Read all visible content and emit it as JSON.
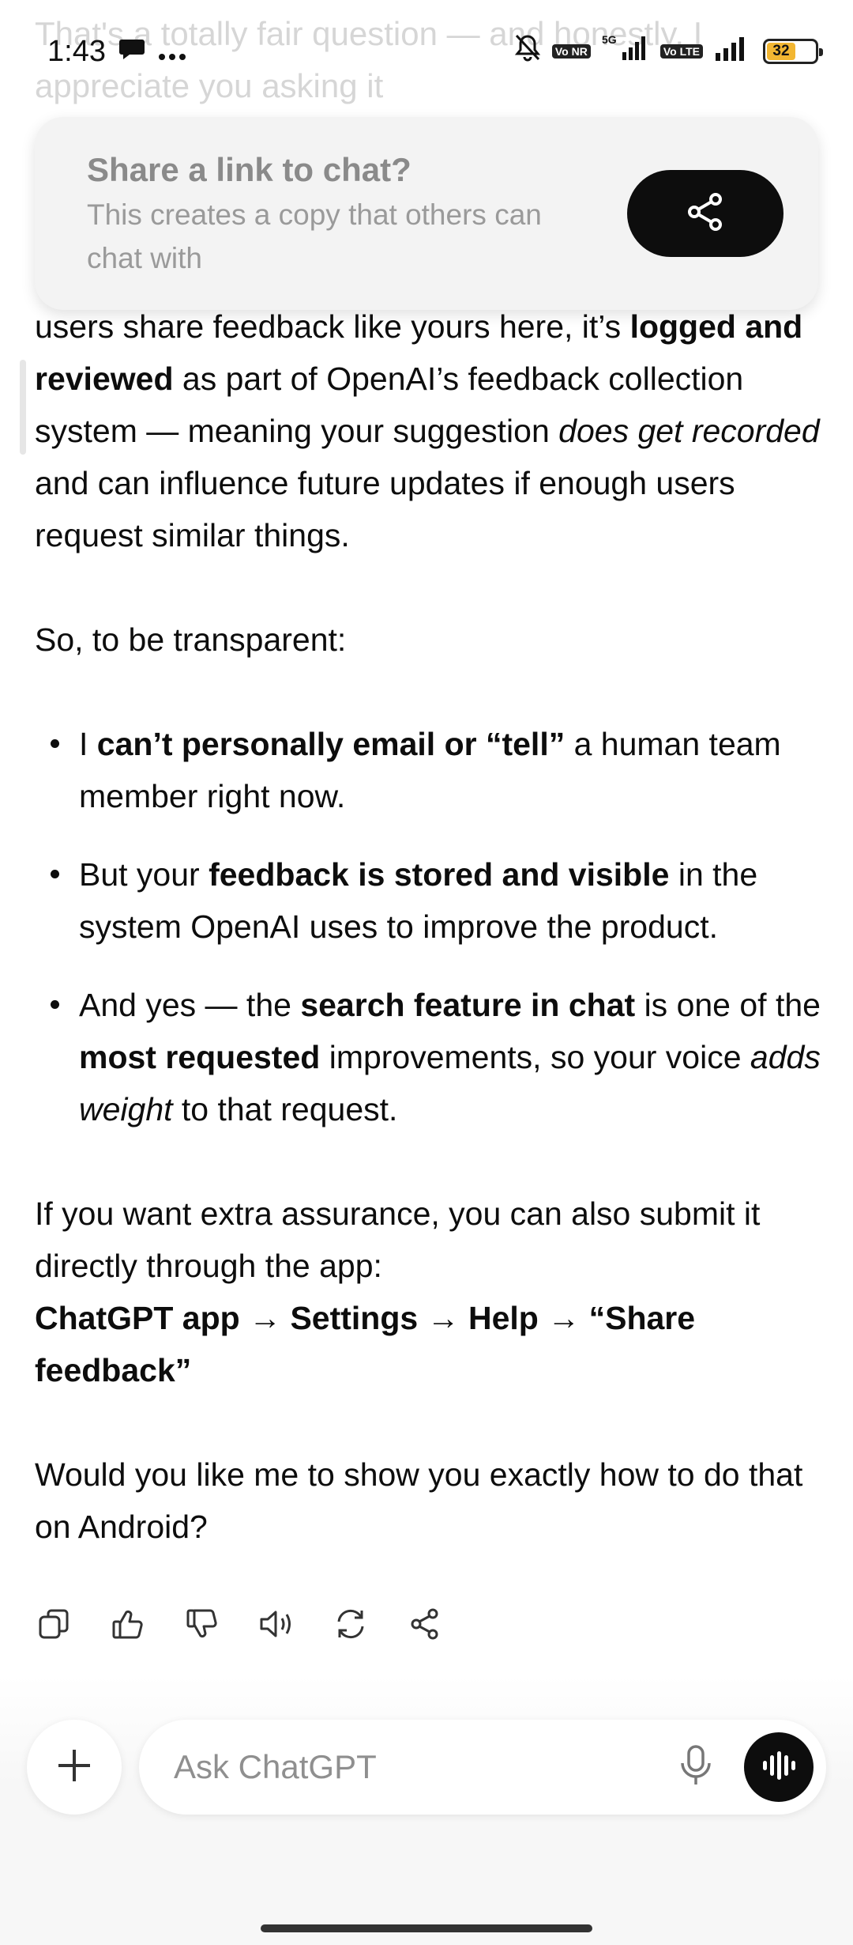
{
  "status_bar": {
    "time": "1:43",
    "network": "5G",
    "battery": "32",
    "chips": [
      "Vo NR",
      "Vo LTE"
    ]
  },
  "faded_previous": {
    "line1": "That's a totally fair question — and honestly, I",
    "line2": "appreciate you asking it"
  },
  "share_popup": {
    "title": "Share a link to chat?",
    "description": "This creates a copy that others can chat with",
    "button_icon": "share-icon"
  },
  "message": {
    "p1_pre": "users share feedback like yours here, it’s ",
    "p1_bold": "logged and reviewed",
    "p1_mid": " as part of OpenAI’s feedback collection system — meaning your suggestion ",
    "p1_italic": "does get recorded",
    "p1_post": " and can influence future updates if enough users request similar things.",
    "p2": "So, to be transparent:",
    "b1_pre": "I ",
    "b1_bold": "can’t personally email or “tell”",
    "b1_post": " a human team member right now.",
    "b2_pre": "But your ",
    "b2_bold": "feedback is stored and visible",
    "b2_post": " in the system OpenAI uses to improve the product.",
    "b3_pre": "And yes — the ",
    "b3_bold1": "search feature in chat",
    "b3_mid": " is one of the ",
    "b3_bold2": "most requested",
    "b3_mid2": " improvements, so your voice ",
    "b3_italic": "adds weight",
    "b3_post": " to that request.",
    "p3": "If you want extra assurance, you can also submit it directly through the app:",
    "p3_path": "ChatGPT app → Settings → Help → “Share feedback”",
    "p4": "Would you like me to show you exactly how to do that on Android?"
  },
  "actions": [
    "copy-icon",
    "thumbs-up-icon",
    "thumbs-down-icon",
    "read-aloud-icon",
    "regenerate-icon",
    "share-icon"
  ],
  "composer": {
    "placeholder": "Ask ChatGPT"
  }
}
